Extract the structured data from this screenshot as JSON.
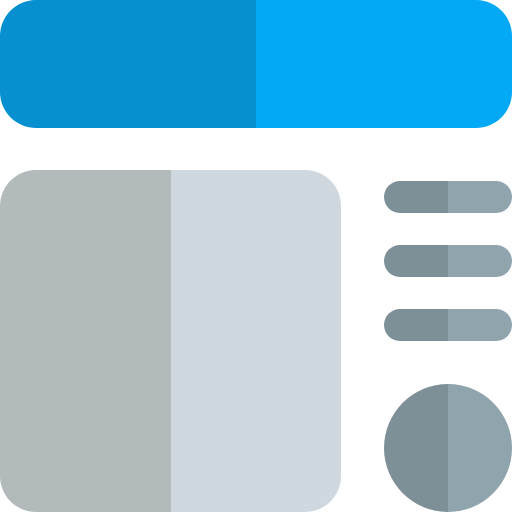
{
  "icon": {
    "name": "website-layout-icon",
    "description_visible_text": ""
  },
  "colors": {
    "header_dark": "#0690D0",
    "header_light": "#03A9F4",
    "content_dark": "#B3BABC",
    "content_light": "#D0D8DF",
    "line_dark": "#7D8F97",
    "line_light": "#90A4AE",
    "circle_dark": "#7D8F97",
    "circle_light": "#90A4AE"
  },
  "structure": {
    "header_bar_count": 1,
    "content_panel_count": 1,
    "list_line_count": 3,
    "avatar_circle_count": 1
  }
}
